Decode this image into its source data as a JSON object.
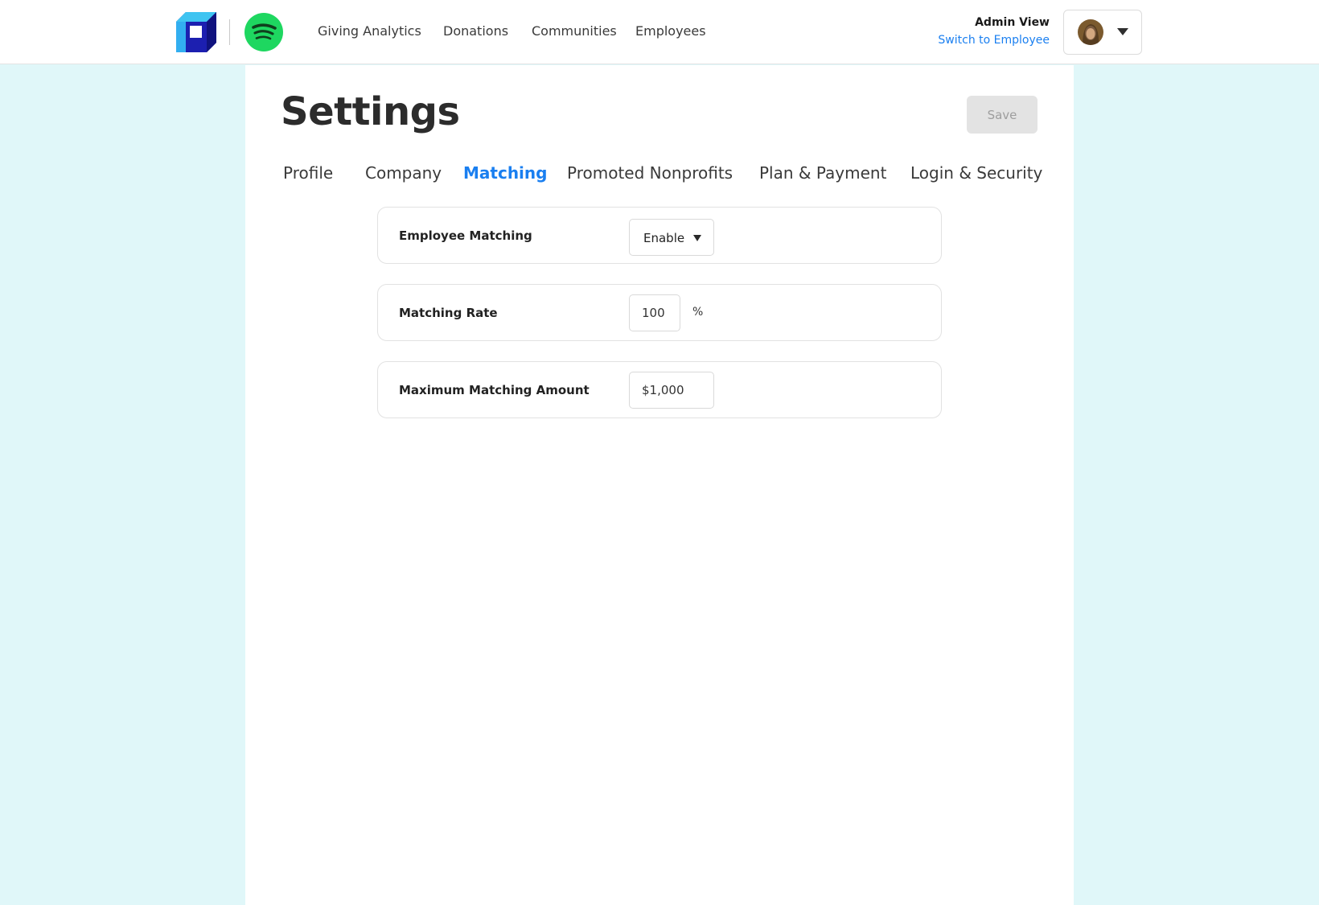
{
  "header": {
    "nav": [
      "Giving Analytics",
      "Donations",
      "Communities",
      "Employees"
    ],
    "admin_view": "Admin View",
    "switch_link": "Switch to Employee"
  },
  "page": {
    "title": "Settings",
    "save_label": "Save",
    "tabs": [
      {
        "label": "Profile",
        "active": false
      },
      {
        "label": "Company",
        "active": false
      },
      {
        "label": "Matching",
        "active": true
      },
      {
        "label": "Promoted Nonprofits",
        "active": false
      },
      {
        "label": "Plan & Payment",
        "active": false
      },
      {
        "label": "Login & Security",
        "active": false
      }
    ]
  },
  "matching": {
    "employee_matching": {
      "label": "Employee Matching",
      "value": "Enable"
    },
    "matching_rate": {
      "label": "Matching Rate",
      "value": "100",
      "unit": "%"
    },
    "max_amount": {
      "label": "Maximum Matching Amount",
      "value": "$1,000"
    }
  },
  "colors": {
    "accent": "#1a7ff0",
    "page_background": "#e0f7f9",
    "spotify_green": "#1ed760"
  }
}
